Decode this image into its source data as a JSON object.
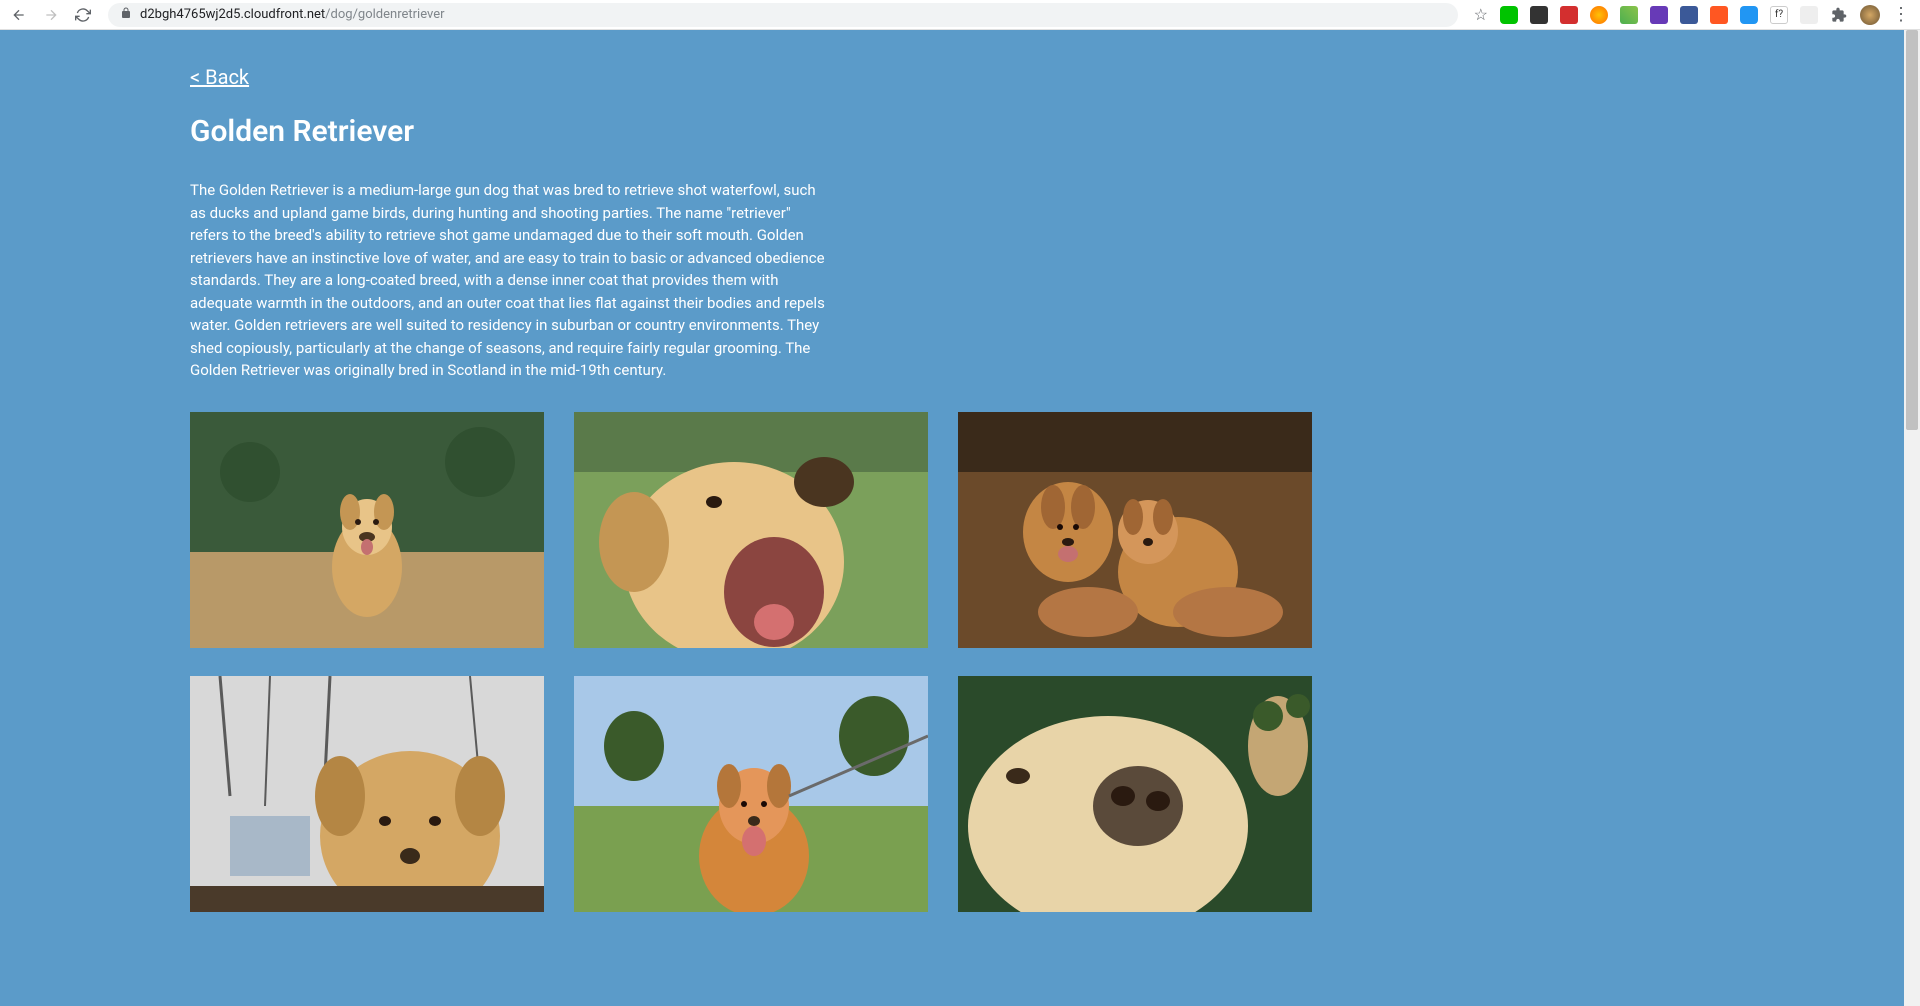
{
  "browser": {
    "url_host": "d2bgh4765wj2d5.cloudfront.net",
    "url_path": "/dog/goldenretriever"
  },
  "page": {
    "back_link": "< Back",
    "title": "Golden Retriever",
    "description": "The Golden Retriever is a medium-large gun dog that was bred to retrieve shot waterfowl, such as ducks and upland game birds, during hunting and shooting parties. The name \"retriever\" refers to the breed's ability to retrieve shot game undamaged due to their soft mouth. Golden retrievers have an instinctive love of water, and are easy to train to basic or advanced obedience standards. They are a long-coated breed, with a dense inner coat that provides them with adequate warmth in the outdoors, and an outer coat that lies flat against their bodies and repels water. Golden retrievers are well suited to residency in suburban or country environments. They shed copiously, particularly at the change of seasons, and require fairly regular grooming. The Golden Retriever was originally bred in Scotland in the mid-19th century."
  },
  "images": [
    {
      "alt": "Golden retriever sitting outdoors on dirt path"
    },
    {
      "alt": "Golden retriever close-up with mouth open"
    },
    {
      "alt": "Two golden retrievers lying on wooden floor"
    },
    {
      "alt": "Golden retriever portrait with bare trees background"
    },
    {
      "alt": "Golden retriever on leash in park"
    },
    {
      "alt": "Golden retriever close-up lying down"
    }
  ]
}
